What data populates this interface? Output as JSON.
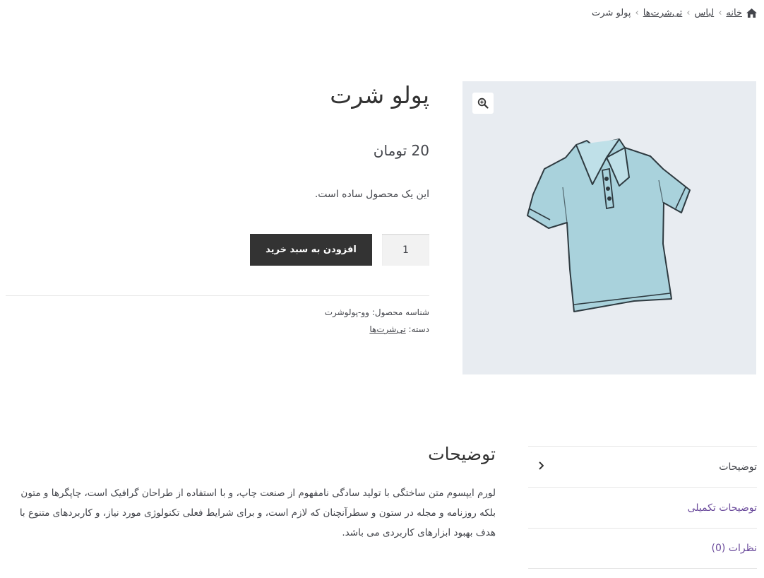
{
  "breadcrumb": {
    "items": [
      "خانه",
      "لباس",
      "تی‌شرت‌ها"
    ],
    "current": "پولو شرت",
    "separator": "›"
  },
  "product": {
    "title": "پولو شرت",
    "price": "20 تومان",
    "short_description": "این یک محصول ساده است.",
    "quantity_value": "1",
    "add_to_cart_label": "افزودن به سبد خرید",
    "sku_label": "شناسه محصول:",
    "sku_value": "وو-پولوشرت",
    "category_label": "دسته:",
    "category_value": "تی‌شرت‌ها"
  },
  "tabs": [
    {
      "label": "توضیحات",
      "active": true
    },
    {
      "label": "توضیحات تکمیلی",
      "active": false
    },
    {
      "label": "نظرات (0)",
      "active": false
    }
  ],
  "description": {
    "title": "توضیحات",
    "text": "لورم ایپسوم متن ساختگی با تولید سادگی نامفهوم از صنعت چاپ، و با استفاده از طراحان گرافیک است، چاپگرها و متون بلکه روزنامه و مجله در ستون و سطرآنچنان که لازم است، و برای شرایط فعلی تکنولوژی مورد نیاز، و کاربردهای متنوع با هدف بهبود ابزارهای کاربردی می باشد."
  },
  "colors": {
    "button_bg": "#333333",
    "gallery_bg": "#e8ecf1",
    "tab_link": "#6a4a9b",
    "shirt_fill": "#a9d2dc"
  }
}
